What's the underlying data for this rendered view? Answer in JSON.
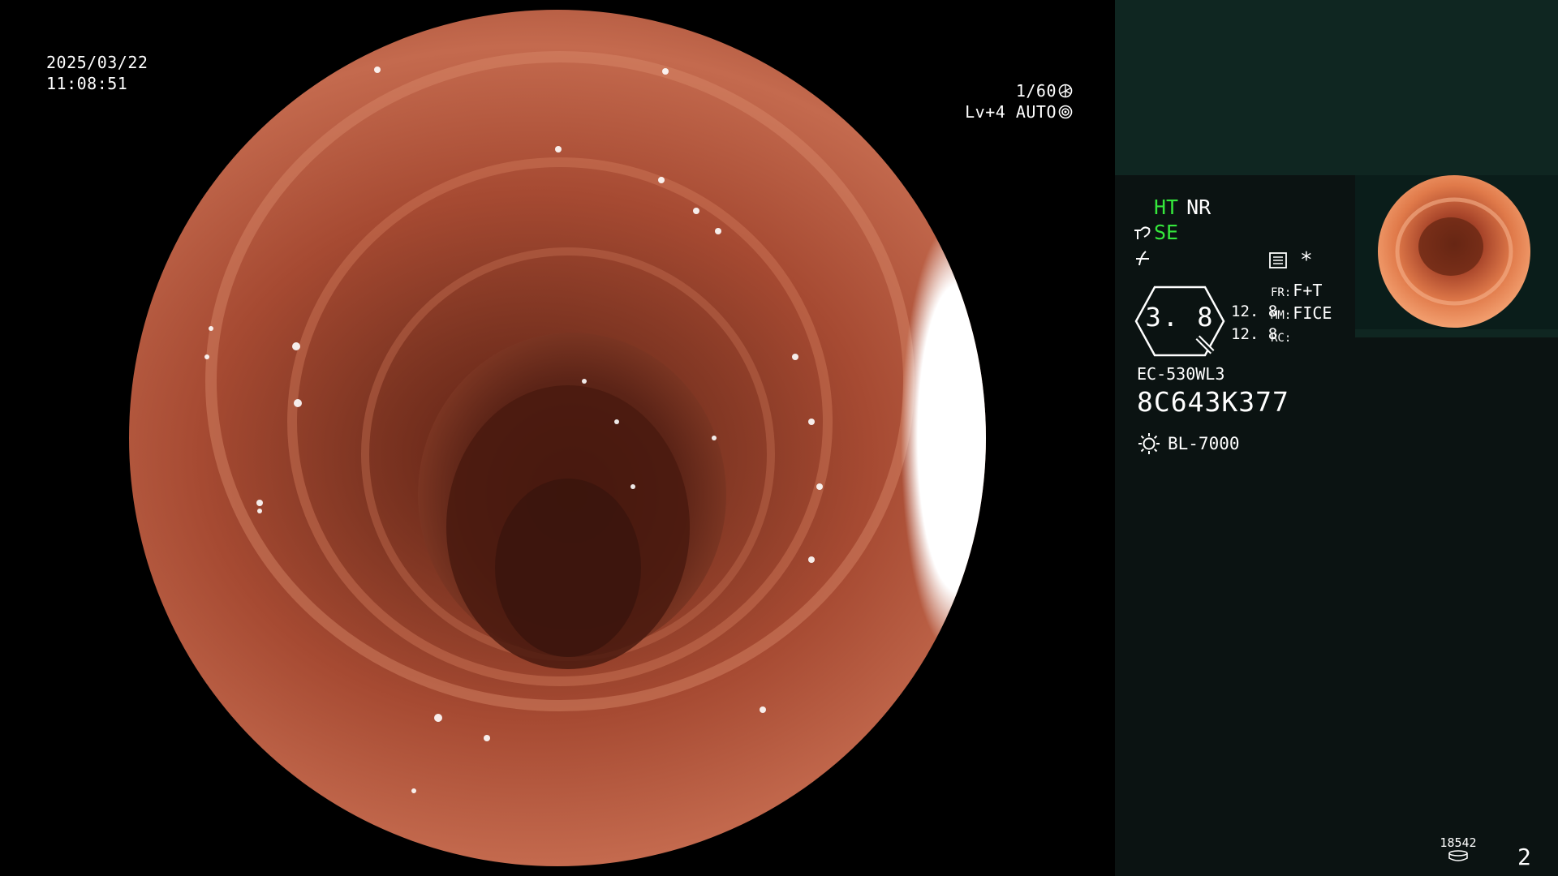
{
  "overlay": {
    "date": "2025/03/22",
    "time": "11:08:51",
    "shutter": "1/60",
    "shutter_icon": "aperture-icon",
    "iris": "Lv+4 AUTO",
    "iris_icon": "iris-icon"
  },
  "panel": {
    "ht_label": "HT",
    "nr_label": "NR",
    "se_label": "SE",
    "enhance_icon": "enhance-curve-icon",
    "gamma_icon": "gamma-icon",
    "menu_icon": "menu-list-icon",
    "asterisk": "*",
    "magnification": "3. 8",
    "sub_value_1": "12. 8",
    "sub_value_2": "12. 8",
    "fr_label": "FR:",
    "fr_value": "F+T",
    "mm_label": "MM:",
    "mm_value": "FICE",
    "rc_label": "RC:",
    "rc_value": "",
    "scope_model": "EC-530WL3",
    "scope_serial": "8C643K377",
    "light_icon": "light-source-icon",
    "light_source": "BL-7000",
    "image_count": "18542",
    "image_count_icon": "storage-icon",
    "page_number": "2"
  },
  "colors": {
    "accent_green": "#35e83c",
    "panel_bg": "#0b1312",
    "panel_header": "#0f2621",
    "text": "#ffffff"
  }
}
